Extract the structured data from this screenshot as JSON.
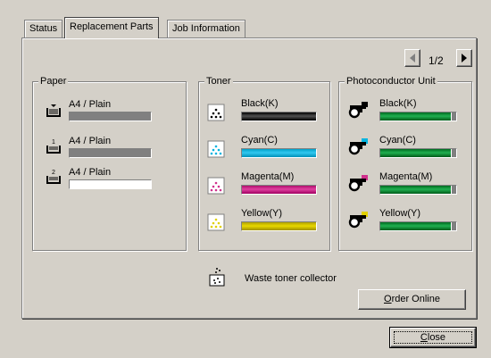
{
  "tabs": [
    {
      "label": "Status"
    },
    {
      "label": "Replacement Parts"
    },
    {
      "label": "Job Information"
    }
  ],
  "pager": {
    "text": "1/2",
    "prev_icon": "triangle-left-icon",
    "next_icon": "triangle-right-icon"
  },
  "paper": {
    "title": "Paper",
    "items": [
      {
        "label": "A4 / Plain",
        "icon": "paper-tray-icon",
        "level": 1.0
      },
      {
        "label": "A4 / Plain",
        "icon": "paper-tray-1-icon",
        "level": 1.0
      },
      {
        "label": "A4 / Plain",
        "icon": "paper-tray-2-icon",
        "level": 0.0
      }
    ]
  },
  "toner": {
    "title": "Toner",
    "items": [
      {
        "label": "Black(K)",
        "color": "#000000",
        "level": 1.0
      },
      {
        "label": "Cyan(C)",
        "color": "#00b4e0",
        "level": 1.0
      },
      {
        "label": "Magenta(M)",
        "color": "#d0308c",
        "level": 1.0
      },
      {
        "label": "Yellow(Y)",
        "color": "#e0d000",
        "level": 1.0
      }
    ]
  },
  "photoconductor": {
    "title": "Photoconductor Unit",
    "items": [
      {
        "label": "Black(K)",
        "color": "#000000",
        "level": 0.93
      },
      {
        "label": "Cyan(C)",
        "color": "#00b4e0",
        "level": 0.93
      },
      {
        "label": "Magenta(M)",
        "color": "#d0308c",
        "level": 0.93
      },
      {
        "label": "Yellow(Y)",
        "color": "#e0d000",
        "level": 0.93
      }
    ]
  },
  "waste": {
    "label": "Waste toner collector",
    "icon": "waste-toner-icon"
  },
  "buttons": {
    "order_online_pre": "",
    "order_online_ul": "O",
    "order_online_post": "rder Online",
    "close_pre": "",
    "close_ul": "C",
    "close_post": "lose"
  }
}
